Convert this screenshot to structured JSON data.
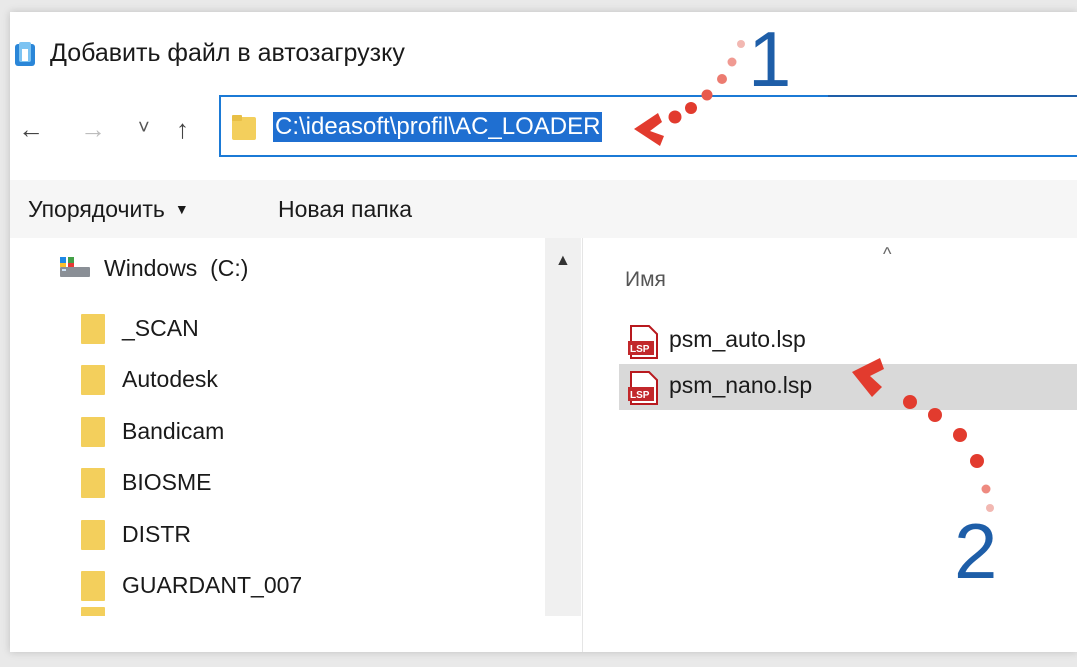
{
  "window": {
    "title": "Добавить файл в автозагрузку"
  },
  "nav": {
    "back_icon": "←",
    "forward_icon": "→",
    "recent_icon": "˅",
    "up_icon": "↑",
    "address": "C:\\ideasoft\\profil\\AC_LOADER"
  },
  "toolbar": {
    "organize": "Упорядочить",
    "organize_caret": "▼",
    "new_folder": "Новая папка"
  },
  "tree": {
    "drive": {
      "name": "Windows",
      "letter": "(C:)"
    },
    "folders": [
      "_SCAN",
      "Autodesk",
      "Bandicam",
      "BIOSME",
      "DISTR",
      "GUARDANT_007"
    ]
  },
  "files": {
    "column_name": "Имя",
    "sort_caret": "^",
    "items": [
      {
        "name": "psm_auto.lsp",
        "icon": "lsp-file-icon",
        "selected": false
      },
      {
        "name": "psm_nano.lsp",
        "icon": "lsp-file-icon",
        "selected": true
      }
    ]
  },
  "annotations": {
    "step1": "1",
    "step2": "2",
    "color": "#1e5ea8",
    "arrow_color": "#e23b2e"
  },
  "colors": {
    "selection_blue": "#1f6fd1",
    "address_border": "#1b7ad6",
    "folder_yellow": "#f3cf5c"
  }
}
